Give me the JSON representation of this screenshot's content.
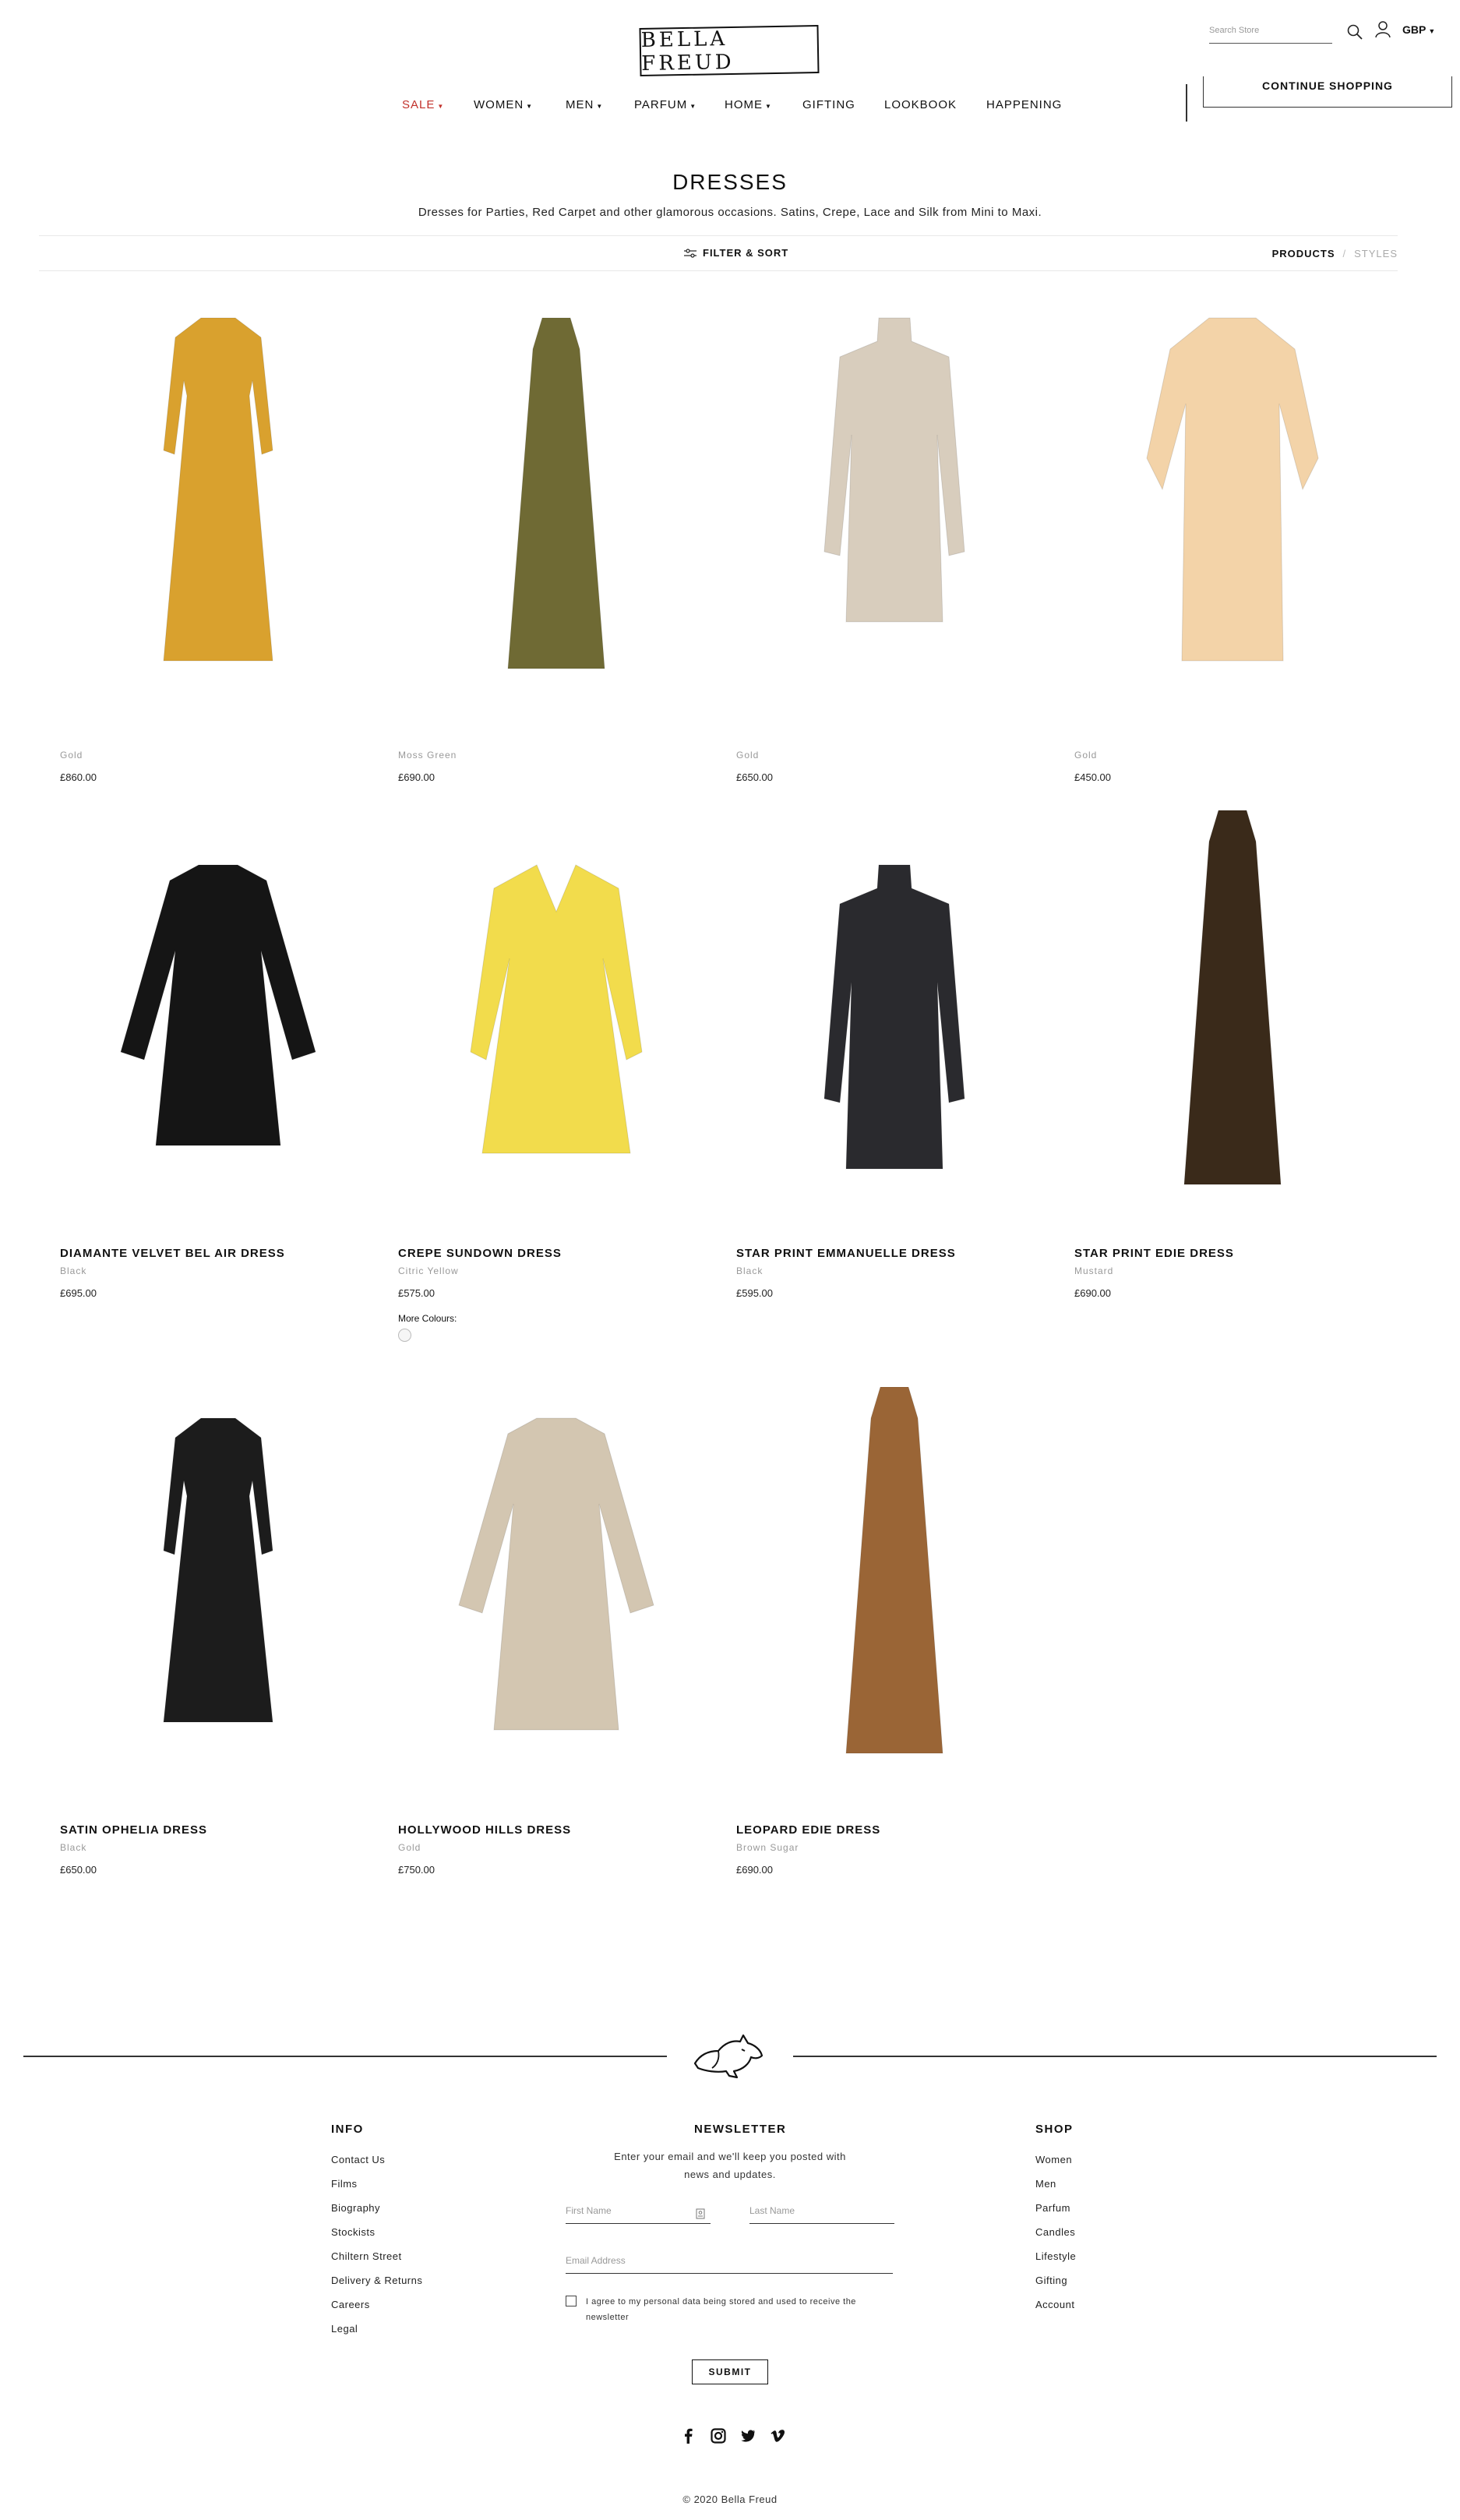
{
  "header": {
    "logo_text": "BELLA FREUD",
    "search_placeholder": "Search Store",
    "currency": "GBP",
    "continue_shopping": "CONTINUE SHOPPING"
  },
  "nav": [
    {
      "label": "SALE",
      "dropdown": true,
      "color": "#c2312b"
    },
    {
      "label": "WOMEN",
      "dropdown": true
    },
    {
      "label": "MEN",
      "dropdown": true
    },
    {
      "label": "PARFUM",
      "dropdown": true
    },
    {
      "label": "HOME",
      "dropdown": true
    },
    {
      "label": "GIFTING",
      "dropdown": false
    },
    {
      "label": "LOOKBOOK",
      "dropdown": false
    },
    {
      "label": "HAPPENING",
      "dropdown": false
    }
  ],
  "page": {
    "title": "DRESSES",
    "description": "Dresses for Parties, Red Carpet and other glamorous occasions. Satins, Crepe, Lace and Silk from Mini to Maxi.",
    "filter_label": "FILTER & SORT",
    "view_products": "PRODUCTS",
    "view_separator": "/",
    "view_styles": "STYLES"
  },
  "products": [
    {
      "name": "",
      "colour": "Gold",
      "price": "£860.00",
      "dress_color": "#d9a12e"
    },
    {
      "name": "",
      "colour": "Moss Green",
      "price": "£690.00",
      "dress_color": "#6f6a34"
    },
    {
      "name": "",
      "colour": "Gold",
      "price": "£650.00",
      "dress_color": "#d8cdbd"
    },
    {
      "name": "",
      "colour": "Gold",
      "price": "£450.00",
      "dress_color": "#f3d3a8"
    },
    {
      "name": "DIAMANTE VELVET BEL AIR DRESS",
      "colour": "Black",
      "price": "£695.00",
      "dress_color": "#151515"
    },
    {
      "name": "CREPE SUNDOWN DRESS",
      "colour": "Citric Yellow",
      "price": "£575.00",
      "dress_color": "#f2dc4c",
      "more_colours": "More Colours:"
    },
    {
      "name": "STAR PRINT EMMANUELLE DRESS",
      "colour": "Black",
      "price": "£595.00",
      "dress_color": "#2a2a2e"
    },
    {
      "name": "STAR PRINT EDIE DRESS",
      "colour": "Mustard",
      "price": "£690.00",
      "dress_color": "#3a2a1a"
    },
    {
      "name": "SATIN OPHELIA DRESS",
      "colour": "Black",
      "price": "£650.00",
      "dress_color": "#1c1c1c"
    },
    {
      "name": "HOLLYWOOD HILLS DRESS",
      "colour": "Gold",
      "price": "£750.00",
      "dress_color": "#d3c6b1"
    },
    {
      "name": "LEOPARD EDIE DRESS",
      "colour": "Brown Sugar",
      "price": "£690.00",
      "dress_color": "#9a6536"
    }
  ],
  "footer": {
    "info_title": "INFO",
    "info_links": [
      "Contact Us",
      "Films",
      "Biography",
      "Stockists",
      "Chiltern Street",
      "Delivery & Returns",
      "Careers",
      "Legal"
    ],
    "newsletter_title": "NEWSLETTER",
    "newsletter_text": "Enter your email and we'll keep you posted with news and updates.",
    "first_name_placeholder": "First Name",
    "last_name_placeholder": "Last Name",
    "email_placeholder": "Email Address",
    "consent_text": "I agree to my personal data being stored and used to receive the newsletter",
    "submit_label": "SUBMIT",
    "shop_title": "SHOP",
    "shop_links": [
      "Women",
      "Men",
      "Parfum",
      "Candles",
      "Lifestyle",
      "Gifting",
      "Account"
    ],
    "social_icons": [
      "facebook-icon",
      "instagram-icon",
      "twitter-icon",
      "vimeo-icon"
    ],
    "copyright": "© 2020 Bella Freud"
  }
}
